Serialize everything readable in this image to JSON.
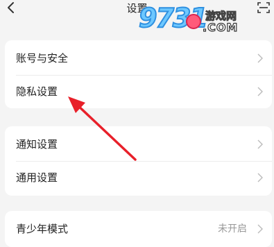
{
  "header": {
    "title": "设置",
    "back_icon": "chevron-left-icon",
    "scan_icon": "scan-icon"
  },
  "watermark": {
    "number": "9731",
    "site_cn": "游戏网",
    "site_com": ".COM"
  },
  "sections": [
    {
      "items": [
        {
          "label": "账号与安全",
          "value": ""
        },
        {
          "label": "隐私设置",
          "value": ""
        }
      ]
    },
    {
      "items": [
        {
          "label": "通知设置",
          "value": ""
        },
        {
          "label": "通用设置",
          "value": ""
        }
      ]
    },
    {
      "items": [
        {
          "label": "青少年模式",
          "value": "未开启"
        }
      ]
    }
  ],
  "colors": {
    "background": "#f4f4f4",
    "card": "#ffffff",
    "annotation_arrow": "#e8202a",
    "secondary_text": "#999999"
  }
}
